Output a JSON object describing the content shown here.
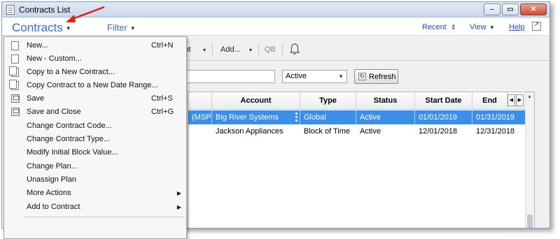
{
  "window": {
    "title": "Contracts List"
  },
  "menubar": {
    "contracts_label": "Contracts",
    "filter_label": "Filter",
    "recent_label": "Recent",
    "view_label": "View",
    "help_label": "Help"
  },
  "toolbar": {
    "print_label": "int",
    "add_label": "Add...",
    "qb_label": "QB"
  },
  "filter": {
    "search_value": "",
    "status_value": "Active",
    "refresh_label": "Refresh"
  },
  "grid": {
    "columns": [
      "Account",
      "Type",
      "Status",
      "Start Date",
      "End"
    ],
    "rows": [
      {
        "prefix": "(MSP)",
        "account": "Big River Systems",
        "type": "Global",
        "status": "Active",
        "start": "01/01/2019",
        "end": "01/31/2019"
      },
      {
        "prefix": "",
        "account": "Jackson Appliances",
        "type": "Block of Time",
        "status": "Active",
        "start": "12/01/2018",
        "end": "12/31/2018"
      }
    ]
  },
  "contracts_menu": {
    "items": [
      {
        "label": "New...",
        "shortcut": "Ctrl+N"
      },
      {
        "label": "New - Custom...",
        "shortcut": ""
      },
      {
        "label": "Copy to a New Contract...",
        "shortcut": ""
      },
      {
        "label": "Copy Contract to a New Date Range...",
        "shortcut": ""
      },
      {
        "label": "Save",
        "shortcut": "Ctrl+S"
      },
      {
        "label": "Save and Close",
        "shortcut": "Ctrl+G"
      },
      {
        "label": "Change Contract Code...",
        "shortcut": ""
      },
      {
        "label": "Change Contract Type...",
        "shortcut": ""
      },
      {
        "label": "Modify Initial Block Value...",
        "shortcut": ""
      },
      {
        "label": "Change Plan...",
        "shortcut": ""
      },
      {
        "label": "Unassign Plan",
        "shortcut": ""
      },
      {
        "label": "More Actions",
        "shortcut": ""
      },
      {
        "label": "Add to Contract",
        "shortcut": ""
      }
    ]
  },
  "colors": {
    "accent": "#3a6fc8",
    "selection": "#3d8ee8",
    "highlight": "#f5f39a",
    "arrow": "#e02020"
  }
}
